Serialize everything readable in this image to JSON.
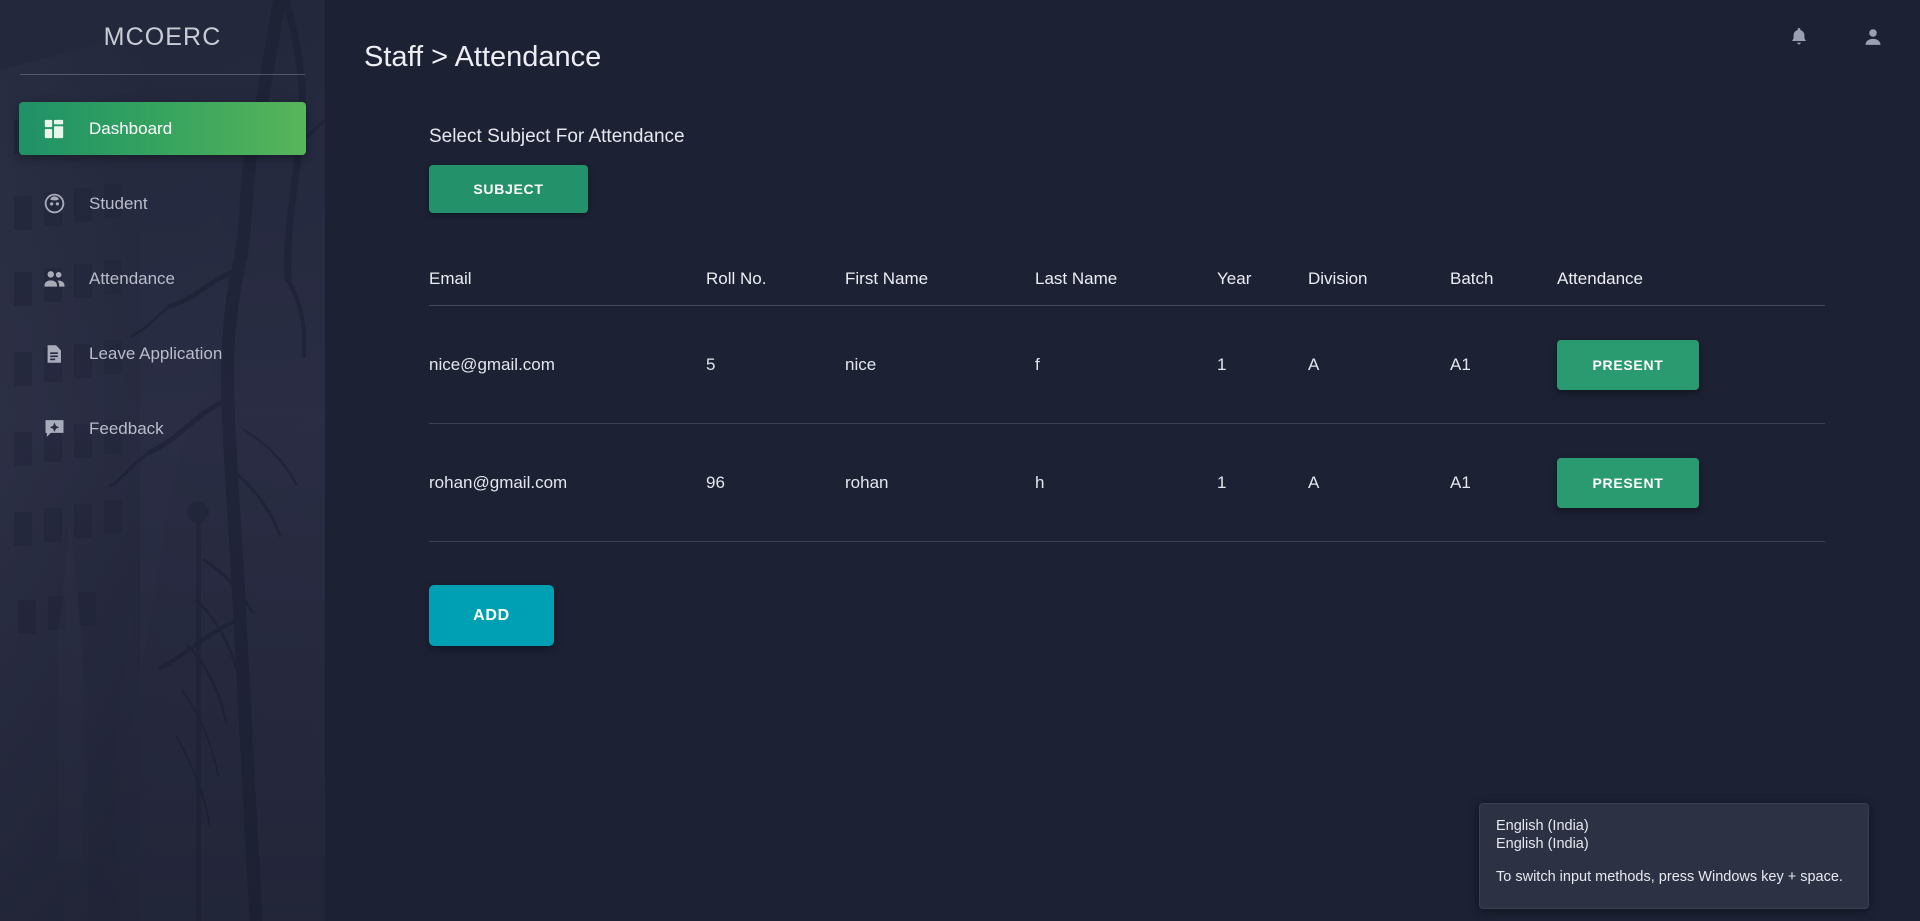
{
  "sidebar": {
    "brand": "MCOERC",
    "items": [
      {
        "label": "Dashboard",
        "icon": "dashboard-grid-icon",
        "active": true
      },
      {
        "label": "Student",
        "icon": "student-face-icon",
        "active": false
      },
      {
        "label": "Attendance",
        "icon": "people-group-icon",
        "active": false
      },
      {
        "label": "Leave Application",
        "icon": "document-icon",
        "active": false
      },
      {
        "label": "Feedback",
        "icon": "feedback-chat-icon",
        "active": false
      }
    ]
  },
  "topbar": {
    "notifications_icon": "bell-icon",
    "account_icon": "person-icon"
  },
  "page": {
    "title": "Staff > Attendance",
    "section_label": "Select Subject For Attendance",
    "subject_button": "SUBJECT",
    "add_button": "ADD"
  },
  "table": {
    "columns": [
      "Email",
      "Roll No.",
      "First Name",
      "Last Name",
      "Year",
      "Division",
      "Batch",
      "Attendance"
    ],
    "rows": [
      {
        "email": "nice@gmail.com",
        "roll": "5",
        "first_name": "nice",
        "last_name": "f",
        "year": "1",
        "division": "A",
        "batch": "A1",
        "attendance": "PRESENT"
      },
      {
        "email": "rohan@gmail.com",
        "roll": "96",
        "first_name": "rohan",
        "last_name": "h",
        "year": "1",
        "division": "A",
        "batch": "A1",
        "attendance": "PRESENT"
      }
    ]
  },
  "ime_popup": {
    "line1": "English (India)",
    "line2": "English (India)",
    "hint": "To switch input methods, press Windows key + space."
  },
  "colors": {
    "app_background": "#1c2134",
    "sidebar_background": "#272c42",
    "active_nav_start": "#1f9167",
    "active_nav_end": "#58b55a",
    "subject_button": "#23916a",
    "present_button": "#2a9a70",
    "add_button": "#00a0b4",
    "popup_background": "#2c3244"
  }
}
